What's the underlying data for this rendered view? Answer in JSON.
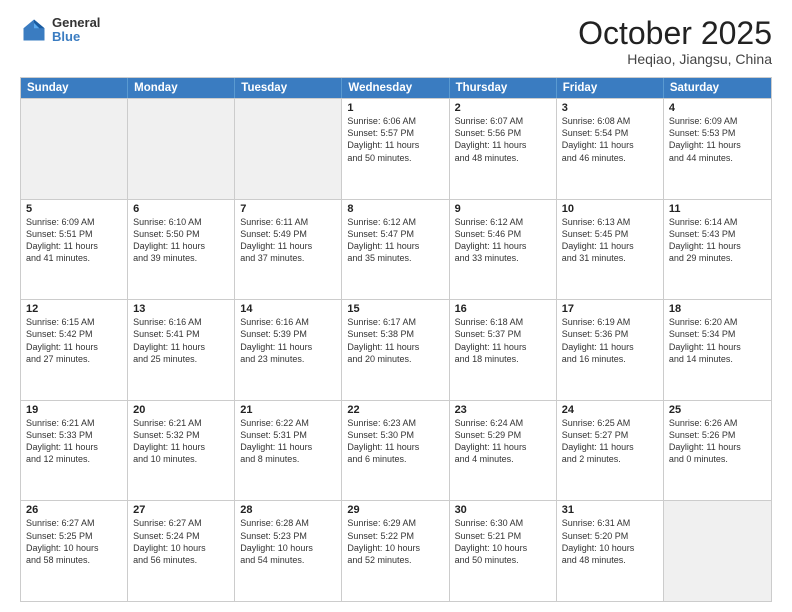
{
  "logo": {
    "line1": "General",
    "line2": "Blue"
  },
  "title": "October 2025",
  "location": "Heqiao, Jiangsu, China",
  "weekdays": [
    "Sunday",
    "Monday",
    "Tuesday",
    "Wednesday",
    "Thursday",
    "Friday",
    "Saturday"
  ],
  "rows": [
    [
      {
        "day": "",
        "info": ""
      },
      {
        "day": "",
        "info": ""
      },
      {
        "day": "",
        "info": ""
      },
      {
        "day": "1",
        "info": "Sunrise: 6:06 AM\nSunset: 5:57 PM\nDaylight: 11 hours\nand 50 minutes."
      },
      {
        "day": "2",
        "info": "Sunrise: 6:07 AM\nSunset: 5:56 PM\nDaylight: 11 hours\nand 48 minutes."
      },
      {
        "day": "3",
        "info": "Sunrise: 6:08 AM\nSunset: 5:54 PM\nDaylight: 11 hours\nand 46 minutes."
      },
      {
        "day": "4",
        "info": "Sunrise: 6:09 AM\nSunset: 5:53 PM\nDaylight: 11 hours\nand 44 minutes."
      }
    ],
    [
      {
        "day": "5",
        "info": "Sunrise: 6:09 AM\nSunset: 5:51 PM\nDaylight: 11 hours\nand 41 minutes."
      },
      {
        "day": "6",
        "info": "Sunrise: 6:10 AM\nSunset: 5:50 PM\nDaylight: 11 hours\nand 39 minutes."
      },
      {
        "day": "7",
        "info": "Sunrise: 6:11 AM\nSunset: 5:49 PM\nDaylight: 11 hours\nand 37 minutes."
      },
      {
        "day": "8",
        "info": "Sunrise: 6:12 AM\nSunset: 5:47 PM\nDaylight: 11 hours\nand 35 minutes."
      },
      {
        "day": "9",
        "info": "Sunrise: 6:12 AM\nSunset: 5:46 PM\nDaylight: 11 hours\nand 33 minutes."
      },
      {
        "day": "10",
        "info": "Sunrise: 6:13 AM\nSunset: 5:45 PM\nDaylight: 11 hours\nand 31 minutes."
      },
      {
        "day": "11",
        "info": "Sunrise: 6:14 AM\nSunset: 5:43 PM\nDaylight: 11 hours\nand 29 minutes."
      }
    ],
    [
      {
        "day": "12",
        "info": "Sunrise: 6:15 AM\nSunset: 5:42 PM\nDaylight: 11 hours\nand 27 minutes."
      },
      {
        "day": "13",
        "info": "Sunrise: 6:16 AM\nSunset: 5:41 PM\nDaylight: 11 hours\nand 25 minutes."
      },
      {
        "day": "14",
        "info": "Sunrise: 6:16 AM\nSunset: 5:39 PM\nDaylight: 11 hours\nand 23 minutes."
      },
      {
        "day": "15",
        "info": "Sunrise: 6:17 AM\nSunset: 5:38 PM\nDaylight: 11 hours\nand 20 minutes."
      },
      {
        "day": "16",
        "info": "Sunrise: 6:18 AM\nSunset: 5:37 PM\nDaylight: 11 hours\nand 18 minutes."
      },
      {
        "day": "17",
        "info": "Sunrise: 6:19 AM\nSunset: 5:36 PM\nDaylight: 11 hours\nand 16 minutes."
      },
      {
        "day": "18",
        "info": "Sunrise: 6:20 AM\nSunset: 5:34 PM\nDaylight: 11 hours\nand 14 minutes."
      }
    ],
    [
      {
        "day": "19",
        "info": "Sunrise: 6:21 AM\nSunset: 5:33 PM\nDaylight: 11 hours\nand 12 minutes."
      },
      {
        "day": "20",
        "info": "Sunrise: 6:21 AM\nSunset: 5:32 PM\nDaylight: 11 hours\nand 10 minutes."
      },
      {
        "day": "21",
        "info": "Sunrise: 6:22 AM\nSunset: 5:31 PM\nDaylight: 11 hours\nand 8 minutes."
      },
      {
        "day": "22",
        "info": "Sunrise: 6:23 AM\nSunset: 5:30 PM\nDaylight: 11 hours\nand 6 minutes."
      },
      {
        "day": "23",
        "info": "Sunrise: 6:24 AM\nSunset: 5:29 PM\nDaylight: 11 hours\nand 4 minutes."
      },
      {
        "day": "24",
        "info": "Sunrise: 6:25 AM\nSunset: 5:27 PM\nDaylight: 11 hours\nand 2 minutes."
      },
      {
        "day": "25",
        "info": "Sunrise: 6:26 AM\nSunset: 5:26 PM\nDaylight: 11 hours\nand 0 minutes."
      }
    ],
    [
      {
        "day": "26",
        "info": "Sunrise: 6:27 AM\nSunset: 5:25 PM\nDaylight: 10 hours\nand 58 minutes."
      },
      {
        "day": "27",
        "info": "Sunrise: 6:27 AM\nSunset: 5:24 PM\nDaylight: 10 hours\nand 56 minutes."
      },
      {
        "day": "28",
        "info": "Sunrise: 6:28 AM\nSunset: 5:23 PM\nDaylight: 10 hours\nand 54 minutes."
      },
      {
        "day": "29",
        "info": "Sunrise: 6:29 AM\nSunset: 5:22 PM\nDaylight: 10 hours\nand 52 minutes."
      },
      {
        "day": "30",
        "info": "Sunrise: 6:30 AM\nSunset: 5:21 PM\nDaylight: 10 hours\nand 50 minutes."
      },
      {
        "day": "31",
        "info": "Sunrise: 6:31 AM\nSunset: 5:20 PM\nDaylight: 10 hours\nand 48 minutes."
      },
      {
        "day": "",
        "info": ""
      }
    ]
  ]
}
